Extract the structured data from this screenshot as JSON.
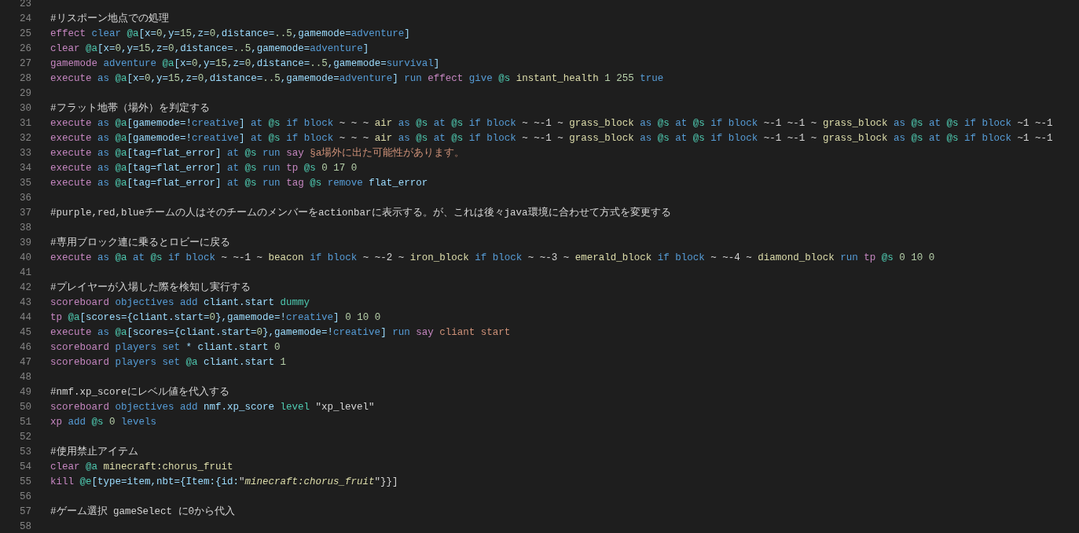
{
  "editor": {
    "lines": [
      {
        "number": "23"
      },
      {
        "number": "24",
        "tokens": [
          {
            "kind": "comment",
            "text": "#リスポーン地点での処理"
          }
        ]
      },
      {
        "number": "25",
        "tokens": [
          {
            "kind": "command",
            "text": "effect "
          },
          {
            "kind": "keyword",
            "text": "clear "
          },
          {
            "kind": "selector",
            "text": "@a"
          },
          {
            "kind": "arg",
            "text": "[x="
          },
          {
            "kind": "number",
            "text": "0"
          },
          {
            "kind": "arg",
            "text": ",y="
          },
          {
            "kind": "number",
            "text": "15"
          },
          {
            "kind": "arg",
            "text": ",z="
          },
          {
            "kind": "number",
            "text": "0"
          },
          {
            "kind": "arg",
            "text": ",distance="
          },
          {
            "kind": "number",
            "text": "..5"
          },
          {
            "kind": "arg",
            "text": ",gamemode="
          },
          {
            "kind": "keyword",
            "text": "adventure"
          },
          {
            "kind": "arg",
            "text": "]"
          }
        ]
      },
      {
        "number": "26",
        "tokens": [
          {
            "kind": "command",
            "text": "clear "
          },
          {
            "kind": "selector",
            "text": "@a"
          },
          {
            "kind": "arg",
            "text": "[x="
          },
          {
            "kind": "number",
            "text": "0"
          },
          {
            "kind": "arg",
            "text": ",y="
          },
          {
            "kind": "number",
            "text": "15"
          },
          {
            "kind": "arg",
            "text": ",z="
          },
          {
            "kind": "number",
            "text": "0"
          },
          {
            "kind": "arg",
            "text": ",distance="
          },
          {
            "kind": "number",
            "text": "..5"
          },
          {
            "kind": "arg",
            "text": ",gamemode="
          },
          {
            "kind": "keyword",
            "text": "adventure"
          },
          {
            "kind": "arg",
            "text": "]"
          }
        ]
      },
      {
        "number": "27",
        "tokens": [
          {
            "kind": "command",
            "text": "gamemode "
          },
          {
            "kind": "keyword",
            "text": "adventure "
          },
          {
            "kind": "selector",
            "text": "@a"
          },
          {
            "kind": "arg",
            "text": "[x="
          },
          {
            "kind": "number",
            "text": "0"
          },
          {
            "kind": "arg",
            "text": ",y="
          },
          {
            "kind": "number",
            "text": "15"
          },
          {
            "kind": "arg",
            "text": ",z="
          },
          {
            "kind": "number",
            "text": "0"
          },
          {
            "kind": "arg",
            "text": ",distance="
          },
          {
            "kind": "number",
            "text": "..5"
          },
          {
            "kind": "arg",
            "text": ",gamemode="
          },
          {
            "kind": "keyword",
            "text": "survival"
          },
          {
            "kind": "arg",
            "text": "]"
          }
        ]
      },
      {
        "number": "28",
        "tokens": [
          {
            "kind": "command",
            "text": "execute "
          },
          {
            "kind": "keyword",
            "text": "as "
          },
          {
            "kind": "selector",
            "text": "@a"
          },
          {
            "kind": "arg",
            "text": "[x="
          },
          {
            "kind": "number",
            "text": "0"
          },
          {
            "kind": "arg",
            "text": ",y="
          },
          {
            "kind": "number",
            "text": "15"
          },
          {
            "kind": "arg",
            "text": ",z="
          },
          {
            "kind": "number",
            "text": "0"
          },
          {
            "kind": "arg",
            "text": ",distance="
          },
          {
            "kind": "number",
            "text": "..5"
          },
          {
            "kind": "arg",
            "text": ",gamemode="
          },
          {
            "kind": "keyword",
            "text": "adventure"
          },
          {
            "kind": "arg",
            "text": "] "
          },
          {
            "kind": "keyword",
            "text": "run "
          },
          {
            "kind": "command",
            "text": "effect "
          },
          {
            "kind": "keyword",
            "text": "give "
          },
          {
            "kind": "selector",
            "text": "@s "
          },
          {
            "kind": "ident",
            "text": "instant_health "
          },
          {
            "kind": "number",
            "text": "1 255 "
          },
          {
            "kind": "keyword",
            "text": "true"
          }
        ]
      },
      {
        "number": "29"
      },
      {
        "number": "30",
        "tokens": [
          {
            "kind": "comment",
            "text": "#フラット地帯（場外）を判定する"
          }
        ]
      },
      {
        "number": "31",
        "tokens": [
          {
            "kind": "command",
            "text": "execute "
          },
          {
            "kind": "keyword",
            "text": "as "
          },
          {
            "kind": "selector",
            "text": "@a"
          },
          {
            "kind": "arg",
            "text": "[gamemode=!"
          },
          {
            "kind": "keyword",
            "text": "creative"
          },
          {
            "kind": "arg",
            "text": "] "
          },
          {
            "kind": "keyword",
            "text": "at "
          },
          {
            "kind": "selector",
            "text": "@s "
          },
          {
            "kind": "keyword",
            "text": "if block "
          },
          {
            "kind": "plain",
            "text": "~ ~ ~ "
          },
          {
            "kind": "ident",
            "text": "air "
          },
          {
            "kind": "keyword",
            "text": "as "
          },
          {
            "kind": "selector",
            "text": "@s "
          },
          {
            "kind": "keyword",
            "text": "at "
          },
          {
            "kind": "selector",
            "text": "@s "
          },
          {
            "kind": "keyword",
            "text": "if block "
          },
          {
            "kind": "plain",
            "text": "~ ~-1 ~ "
          },
          {
            "kind": "ident",
            "text": "grass_block "
          },
          {
            "kind": "keyword",
            "text": "as "
          },
          {
            "kind": "selector",
            "text": "@s "
          },
          {
            "kind": "keyword",
            "text": "at "
          },
          {
            "kind": "selector",
            "text": "@s "
          },
          {
            "kind": "keyword",
            "text": "if block "
          },
          {
            "kind": "plain",
            "text": "~-1 ~-1 ~ "
          },
          {
            "kind": "ident",
            "text": "grass_block "
          },
          {
            "kind": "keyword",
            "text": "as "
          },
          {
            "kind": "selector",
            "text": "@s "
          },
          {
            "kind": "keyword",
            "text": "at "
          },
          {
            "kind": "selector",
            "text": "@s "
          },
          {
            "kind": "keyword",
            "text": "if block "
          },
          {
            "kind": "plain",
            "text": "~1 ~-1"
          }
        ]
      },
      {
        "number": "32",
        "tokens": [
          {
            "kind": "command",
            "text": "execute "
          },
          {
            "kind": "keyword",
            "text": "as "
          },
          {
            "kind": "selector",
            "text": "@a"
          },
          {
            "kind": "arg",
            "text": "[gamemode=!"
          },
          {
            "kind": "keyword",
            "text": "creative"
          },
          {
            "kind": "arg",
            "text": "] "
          },
          {
            "kind": "keyword",
            "text": "at "
          },
          {
            "kind": "selector",
            "text": "@s "
          },
          {
            "kind": "keyword",
            "text": "if block "
          },
          {
            "kind": "plain",
            "text": "~ ~ ~ "
          },
          {
            "kind": "ident",
            "text": "air "
          },
          {
            "kind": "keyword",
            "text": "as "
          },
          {
            "kind": "selector",
            "text": "@s "
          },
          {
            "kind": "keyword",
            "text": "at "
          },
          {
            "kind": "selector",
            "text": "@s "
          },
          {
            "kind": "keyword",
            "text": "if block "
          },
          {
            "kind": "plain",
            "text": "~ ~-1 ~ "
          },
          {
            "kind": "ident",
            "text": "grass_block "
          },
          {
            "kind": "keyword",
            "text": "as "
          },
          {
            "kind": "selector",
            "text": "@s "
          },
          {
            "kind": "keyword",
            "text": "at "
          },
          {
            "kind": "selector",
            "text": "@s "
          },
          {
            "kind": "keyword",
            "text": "if block "
          },
          {
            "kind": "plain",
            "text": "~-1 ~-1 ~ "
          },
          {
            "kind": "ident",
            "text": "grass_block "
          },
          {
            "kind": "keyword",
            "text": "as "
          },
          {
            "kind": "selector",
            "text": "@s "
          },
          {
            "kind": "keyword",
            "text": "at "
          },
          {
            "kind": "selector",
            "text": "@s "
          },
          {
            "kind": "keyword",
            "text": "if block "
          },
          {
            "kind": "plain",
            "text": "~1 ~-1"
          }
        ]
      },
      {
        "number": "33",
        "tokens": [
          {
            "kind": "command",
            "text": "execute "
          },
          {
            "kind": "keyword",
            "text": "as "
          },
          {
            "kind": "selector",
            "text": "@a"
          },
          {
            "kind": "arg",
            "text": "[tag=flat_error] "
          },
          {
            "kind": "keyword",
            "text": "at "
          },
          {
            "kind": "selector",
            "text": "@s "
          },
          {
            "kind": "keyword",
            "text": "run "
          },
          {
            "kind": "command",
            "text": "say "
          },
          {
            "kind": "string",
            "text": "§a場外に出た可能性があります。"
          }
        ]
      },
      {
        "number": "34",
        "tokens": [
          {
            "kind": "command",
            "text": "execute "
          },
          {
            "kind": "keyword",
            "text": "as "
          },
          {
            "kind": "selector",
            "text": "@a"
          },
          {
            "kind": "arg",
            "text": "[tag=flat_error] "
          },
          {
            "kind": "keyword",
            "text": "at "
          },
          {
            "kind": "selector",
            "text": "@s "
          },
          {
            "kind": "keyword",
            "text": "run "
          },
          {
            "kind": "command",
            "text": "tp "
          },
          {
            "kind": "selector",
            "text": "@s "
          },
          {
            "kind": "number",
            "text": "0 17 0"
          }
        ]
      },
      {
        "number": "35",
        "tokens": [
          {
            "kind": "command",
            "text": "execute "
          },
          {
            "kind": "keyword",
            "text": "as "
          },
          {
            "kind": "selector",
            "text": "@a"
          },
          {
            "kind": "arg",
            "text": "[tag=flat_error] "
          },
          {
            "kind": "keyword",
            "text": "at "
          },
          {
            "kind": "selector",
            "text": "@s "
          },
          {
            "kind": "keyword",
            "text": "run "
          },
          {
            "kind": "command",
            "text": "tag "
          },
          {
            "kind": "selector",
            "text": "@s "
          },
          {
            "kind": "keyword",
            "text": "remove "
          },
          {
            "kind": "arg",
            "text": "flat_error"
          }
        ]
      },
      {
        "number": "36"
      },
      {
        "number": "37",
        "tokens": [
          {
            "kind": "comment",
            "text": "#purple,red,blueチームの人はそのチームのメンバーをactionbarに表示する。が、これは後々java環境に合わせて方式を変更する"
          }
        ]
      },
      {
        "number": "38"
      },
      {
        "number": "39",
        "tokens": [
          {
            "kind": "comment",
            "text": "#専用ブロック連に乗るとロビーに戻る"
          }
        ]
      },
      {
        "number": "40",
        "tokens": [
          {
            "kind": "command",
            "text": "execute "
          },
          {
            "kind": "keyword",
            "text": "as "
          },
          {
            "kind": "selector",
            "text": "@a "
          },
          {
            "kind": "keyword",
            "text": "at "
          },
          {
            "kind": "selector",
            "text": "@s "
          },
          {
            "kind": "keyword",
            "text": "if block "
          },
          {
            "kind": "plain",
            "text": "~ ~-1 ~ "
          },
          {
            "kind": "ident",
            "text": "beacon "
          },
          {
            "kind": "keyword",
            "text": "if block "
          },
          {
            "kind": "plain",
            "text": "~ ~-2 ~ "
          },
          {
            "kind": "ident",
            "text": "iron_block "
          },
          {
            "kind": "keyword",
            "text": "if block "
          },
          {
            "kind": "plain",
            "text": "~ ~-3 ~ "
          },
          {
            "kind": "ident",
            "text": "emerald_block "
          },
          {
            "kind": "keyword",
            "text": "if block "
          },
          {
            "kind": "plain",
            "text": "~ ~-4 ~ "
          },
          {
            "kind": "ident",
            "text": "diamond_block "
          },
          {
            "kind": "keyword",
            "text": "run "
          },
          {
            "kind": "command",
            "text": "tp "
          },
          {
            "kind": "selector",
            "text": "@s "
          },
          {
            "kind": "number",
            "text": "0 10 0"
          }
        ]
      },
      {
        "number": "41"
      },
      {
        "number": "42",
        "tokens": [
          {
            "kind": "comment",
            "text": "#プレイヤーが入場した際を検知し実行する"
          }
        ]
      },
      {
        "number": "43",
        "tokens": [
          {
            "kind": "command",
            "text": "scoreboard "
          },
          {
            "kind": "keyword",
            "text": "objectives add "
          },
          {
            "kind": "arg",
            "text": "cliant.start "
          },
          {
            "kind": "enum",
            "text": "dummy"
          }
        ]
      },
      {
        "number": "44",
        "tokens": [
          {
            "kind": "command",
            "text": "tp "
          },
          {
            "kind": "selector",
            "text": "@a"
          },
          {
            "kind": "arg",
            "text": "[scores={cliant.start="
          },
          {
            "kind": "number",
            "text": "0"
          },
          {
            "kind": "arg",
            "text": "},gamemode=!"
          },
          {
            "kind": "keyword",
            "text": "creative"
          },
          {
            "kind": "arg",
            "text": "] "
          },
          {
            "kind": "number",
            "text": "0 10 0"
          }
        ]
      },
      {
        "number": "45",
        "tokens": [
          {
            "kind": "command",
            "text": "execute "
          },
          {
            "kind": "keyword",
            "text": "as "
          },
          {
            "kind": "selector",
            "text": "@a"
          },
          {
            "kind": "arg",
            "text": "[scores={cliant.start="
          },
          {
            "kind": "number",
            "text": "0"
          },
          {
            "kind": "arg",
            "text": "},gamemode=!"
          },
          {
            "kind": "keyword",
            "text": "creative"
          },
          {
            "kind": "arg",
            "text": "] "
          },
          {
            "kind": "keyword",
            "text": "run "
          },
          {
            "kind": "command",
            "text": "say "
          },
          {
            "kind": "string",
            "text": "cliant start"
          }
        ]
      },
      {
        "number": "46",
        "tokens": [
          {
            "kind": "command",
            "text": "scoreboard "
          },
          {
            "kind": "keyword",
            "text": "players set "
          },
          {
            "kind": "arg",
            "text": "* cliant.start "
          },
          {
            "kind": "number",
            "text": "0"
          }
        ]
      },
      {
        "number": "47",
        "tokens": [
          {
            "kind": "command",
            "text": "scoreboard "
          },
          {
            "kind": "keyword",
            "text": "players set "
          },
          {
            "kind": "selector",
            "text": "@a "
          },
          {
            "kind": "arg",
            "text": "cliant.start "
          },
          {
            "kind": "number",
            "text": "1"
          }
        ]
      },
      {
        "number": "48"
      },
      {
        "number": "49",
        "tokens": [
          {
            "kind": "comment",
            "text": "#nmf.xp_scoreにレベル値を代入する"
          }
        ]
      },
      {
        "number": "50",
        "tokens": [
          {
            "kind": "command",
            "text": "scoreboard "
          },
          {
            "kind": "keyword",
            "text": "objectives add "
          },
          {
            "kind": "arg",
            "text": "nmf.xp_score "
          },
          {
            "kind": "enum",
            "text": "level "
          },
          {
            "kind": "plain",
            "text": "\"xp_level\""
          }
        ]
      },
      {
        "number": "51",
        "tokens": [
          {
            "kind": "command",
            "text": "xp "
          },
          {
            "kind": "keyword",
            "text": "add "
          },
          {
            "kind": "selector",
            "text": "@s "
          },
          {
            "kind": "number",
            "text": "0 "
          },
          {
            "kind": "keyword",
            "text": "levels"
          }
        ]
      },
      {
        "number": "52"
      },
      {
        "number": "53",
        "tokens": [
          {
            "kind": "comment",
            "text": "#使用禁止アイテム"
          }
        ]
      },
      {
        "number": "54",
        "tokens": [
          {
            "kind": "command",
            "text": "clear "
          },
          {
            "kind": "selector",
            "text": "@a "
          },
          {
            "kind": "ident",
            "text": "minecraft:chorus_fruit"
          }
        ]
      },
      {
        "number": "55",
        "tokens": [
          {
            "kind": "command",
            "text": "kill "
          },
          {
            "kind": "selector",
            "text": "@e"
          },
          {
            "kind": "arg",
            "text": "[type=item,nbt={Item:{id:"
          },
          {
            "kind": "plain",
            "text": "\""
          },
          {
            "kind": "italic",
            "text": "minecraft:chorus_fruit"
          },
          {
            "kind": "plain",
            "text": "\"}}]"
          }
        ]
      },
      {
        "number": "56"
      },
      {
        "number": "57",
        "tokens": [
          {
            "kind": "comment",
            "text": "#ゲーム選択 gameSelect に0から代入"
          }
        ]
      },
      {
        "number": "58"
      }
    ]
  }
}
